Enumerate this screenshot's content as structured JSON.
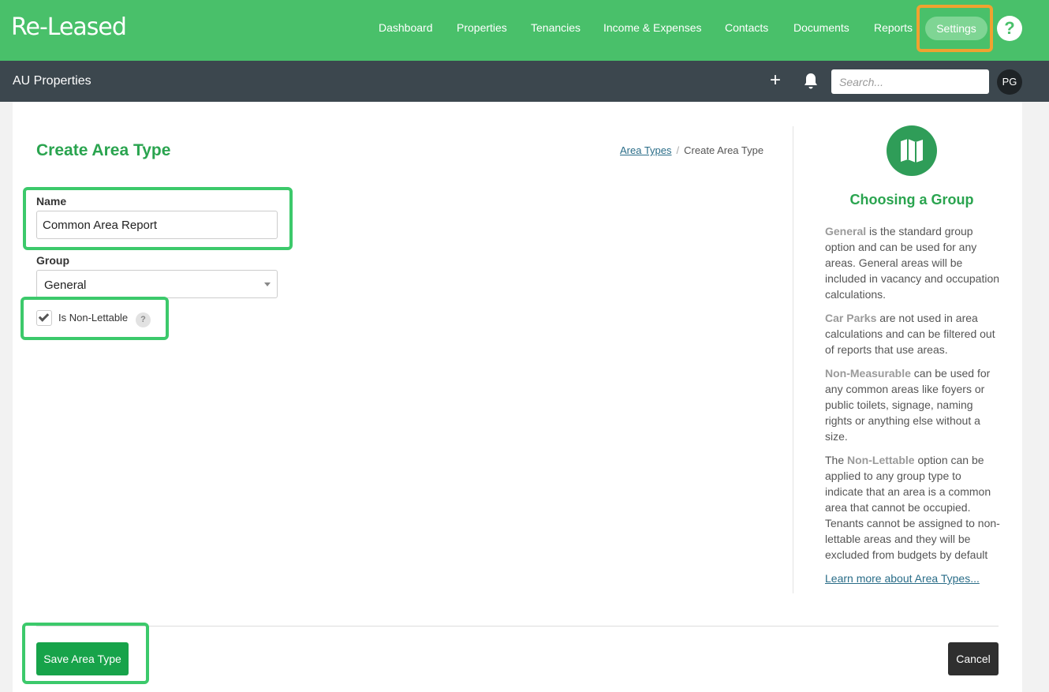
{
  "brand": {
    "logo": "Re-Leased",
    "accent": "#49c06a",
    "subbar_color": "#3c474e",
    "highlight_orange": "#f0a230",
    "highlight_green": "#3cc96b"
  },
  "nav": {
    "items": [
      {
        "label": "Dashboard"
      },
      {
        "label": "Properties"
      },
      {
        "label": "Tenancies"
      },
      {
        "label": "Income & Expenses"
      },
      {
        "label": "Contacts"
      },
      {
        "label": "Documents"
      },
      {
        "label": "Reports"
      }
    ],
    "settings_label": "Settings",
    "help_icon": "?"
  },
  "subbar": {
    "title": "AU Properties",
    "add_icon": "+",
    "search_placeholder": "Search...",
    "avatar_initials": "PG"
  },
  "page": {
    "title": "Create Area Type",
    "breadcrumb": {
      "link": "Area Types",
      "separator": "/",
      "current": "Create Area Type"
    }
  },
  "form": {
    "name_label": "Name",
    "name_value": "Common Area Report",
    "group_label": "Group",
    "group_value": "General",
    "non_lettable_label": "Is Non-Lettable",
    "non_lettable_checked": true,
    "help_hint": "?"
  },
  "side": {
    "icon": "map-icon",
    "heading": "Choosing a Group",
    "p1_bold": "General",
    "p1_text": " is the standard group option and can be used for any areas. General areas will be included in vacancy and occupation calculations.",
    "p2_bold": "Car Parks",
    "p2_text": " are not used in area calculations and can be filtered out of reports that use areas.",
    "p3_bold": "Non-Measurable",
    "p3_text": " can be used for any common areas like foyers or public toilets, signage, naming rights or anything else without a size.",
    "p4_pre": "The ",
    "p4_bold": "Non-Lettable",
    "p4_text": " option can be applied to any group type to indicate that an area is a common area that cannot be occupied. Tenants cannot be assigned to non-lettable areas and they will be excluded from budgets by default",
    "link": "Learn more about Area Types..."
  },
  "actions": {
    "save_label": "Save Area Type",
    "cancel_label": "Cancel"
  }
}
